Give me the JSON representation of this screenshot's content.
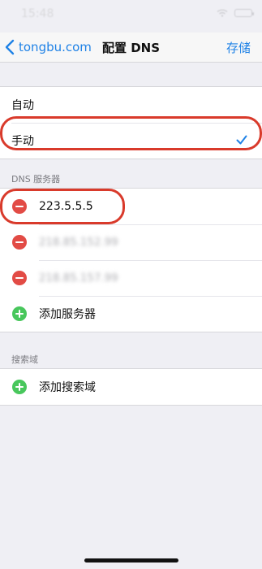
{
  "status_bar": {
    "time": "15:48",
    "wifi_icon": "wifi-icon",
    "battery_icon": "battery-icon"
  },
  "navbar": {
    "back_label": "tongbu.com",
    "back_icon": "chevron-left-icon",
    "title": "配置 DNS",
    "save_label": "存储"
  },
  "dns_mode": {
    "options": [
      {
        "label": "自动",
        "selected": false
      },
      {
        "label": "手动",
        "selected": true
      }
    ]
  },
  "dns_servers": {
    "header": "DNS 服务器",
    "servers": [
      {
        "address": "223.5.5.5"
      },
      {
        "address": "218.85.152.99"
      },
      {
        "address": "218.85.157.99"
      }
    ],
    "add_label": "添加服务器"
  },
  "search_domains": {
    "header": "搜索域",
    "add_label": "添加搜索域"
  },
  "colors": {
    "accent": "#1f82e6",
    "delete": "#e24b45",
    "add": "#48c75c",
    "annotation": "#d93a2b"
  }
}
